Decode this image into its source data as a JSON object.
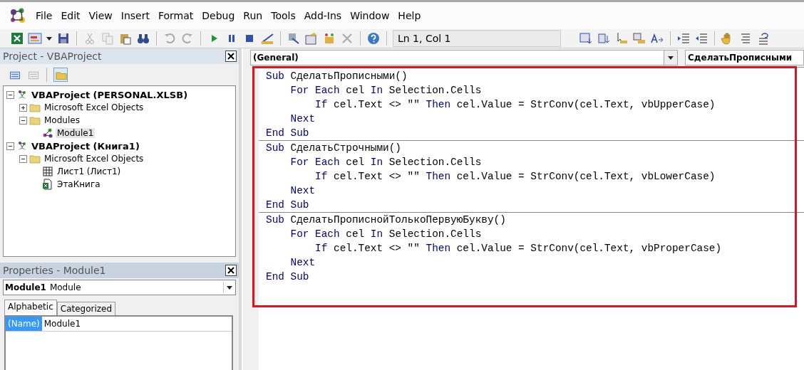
{
  "menu": [
    "File",
    "Edit",
    "View",
    "Insert",
    "Format",
    "Debug",
    "Run",
    "Tools",
    "Add-Ins",
    "Window",
    "Help"
  ],
  "toolbar": {
    "position": "Ln 1, Col 1"
  },
  "project_pane": {
    "title": "Project - VBAProject",
    "tree": [
      {
        "label": "VBAProject (PERSONAL.XLSB)",
        "kind": "project",
        "expanded": true,
        "selected": false,
        "children": [
          {
            "label": "Microsoft Excel Objects",
            "kind": "folder",
            "expanded": false,
            "selected": false
          },
          {
            "label": "Modules",
            "kind": "folder",
            "expanded": true,
            "selected": false,
            "children": [
              {
                "label": "Module1",
                "kind": "module",
                "selected": true
              }
            ]
          }
        ]
      },
      {
        "label": "VBAProject (Книга1)",
        "kind": "project",
        "expanded": true,
        "selected": false,
        "children": [
          {
            "label": "Microsoft Excel Objects",
            "kind": "folder",
            "expanded": true,
            "selected": false,
            "children": [
              {
                "label": "Лист1 (Лист1)",
                "kind": "sheet",
                "selected": false
              },
              {
                "label": "ЭтаКнига",
                "kind": "workbook",
                "selected": false
              }
            ]
          }
        ]
      }
    ]
  },
  "properties_pane": {
    "title": "Properties - Module1",
    "object_name": "Module1",
    "object_type": "Module",
    "tabs": [
      {
        "label": "Alphabetic",
        "selected": true
      },
      {
        "label": "Categorized",
        "selected": false
      }
    ],
    "rows": [
      {
        "name": "(Name)",
        "value": "Module1",
        "selected": true
      }
    ]
  },
  "code_window": {
    "object_combo": "(General)",
    "procedure_combo": "СделатьПрописными",
    "procedures": [
      {
        "lines": [
          [
            {
              "kind": "keyword",
              "text": "Sub"
            },
            {
              "kind": "plain",
              "text": " СделатьПрописными()"
            }
          ],
          [
            {
              "kind": "keyword",
              "text": "    For Each"
            },
            {
              "kind": "plain",
              "text": " cel "
            },
            {
              "kind": "keyword",
              "text": "In"
            },
            {
              "kind": "plain",
              "text": " Selection.Cells"
            }
          ],
          [
            {
              "kind": "keyword",
              "text": "        If"
            },
            {
              "kind": "plain",
              "text": " cel.Text <> \"\" "
            },
            {
              "kind": "keyword",
              "text": "Then"
            },
            {
              "kind": "plain",
              "text": " cel.Value = StrConv(cel.Text, vbUpperCase)"
            }
          ],
          [
            {
              "kind": "keyword",
              "text": "    Next"
            }
          ],
          [
            {
              "kind": "keyword",
              "text": "End Sub"
            }
          ]
        ]
      },
      {
        "lines": [
          [
            {
              "kind": "keyword",
              "text": "Sub"
            },
            {
              "kind": "plain",
              "text": " СделатьСтрочными()"
            }
          ],
          [
            {
              "kind": "keyword",
              "text": "    For Each"
            },
            {
              "kind": "plain",
              "text": " cel "
            },
            {
              "kind": "keyword",
              "text": "In"
            },
            {
              "kind": "plain",
              "text": " Selection.Cells"
            }
          ],
          [
            {
              "kind": "keyword",
              "text": "        If"
            },
            {
              "kind": "plain",
              "text": " cel.Text <> \"\" "
            },
            {
              "kind": "keyword",
              "text": "Then"
            },
            {
              "kind": "plain",
              "text": " cel.Value = StrConv(cel.Text, vbLowerCase)"
            }
          ],
          [
            {
              "kind": "keyword",
              "text": "    Next"
            }
          ],
          [
            {
              "kind": "keyword",
              "text": "End Sub"
            }
          ]
        ]
      },
      {
        "lines": [
          [
            {
              "kind": "keyword",
              "text": "Sub"
            },
            {
              "kind": "plain",
              "text": " СделатьПрописнойТолькоПервуюБукву()"
            }
          ],
          [
            {
              "kind": "keyword",
              "text": "    For Each"
            },
            {
              "kind": "plain",
              "text": " cel "
            },
            {
              "kind": "keyword",
              "text": "In"
            },
            {
              "kind": "plain",
              "text": " Selection.Cells"
            }
          ],
          [
            {
              "kind": "keyword",
              "text": "        If"
            },
            {
              "kind": "plain",
              "text": " cel.Text <> \"\" "
            },
            {
              "kind": "keyword",
              "text": "Then"
            },
            {
              "kind": "plain",
              "text": " cel.Value = StrConv(cel.Text, vbProperCase)"
            }
          ],
          [
            {
              "kind": "keyword",
              "text": "    Next"
            }
          ],
          [
            {
              "kind": "keyword",
              "text": "End Sub"
            }
          ]
        ]
      }
    ]
  }
}
